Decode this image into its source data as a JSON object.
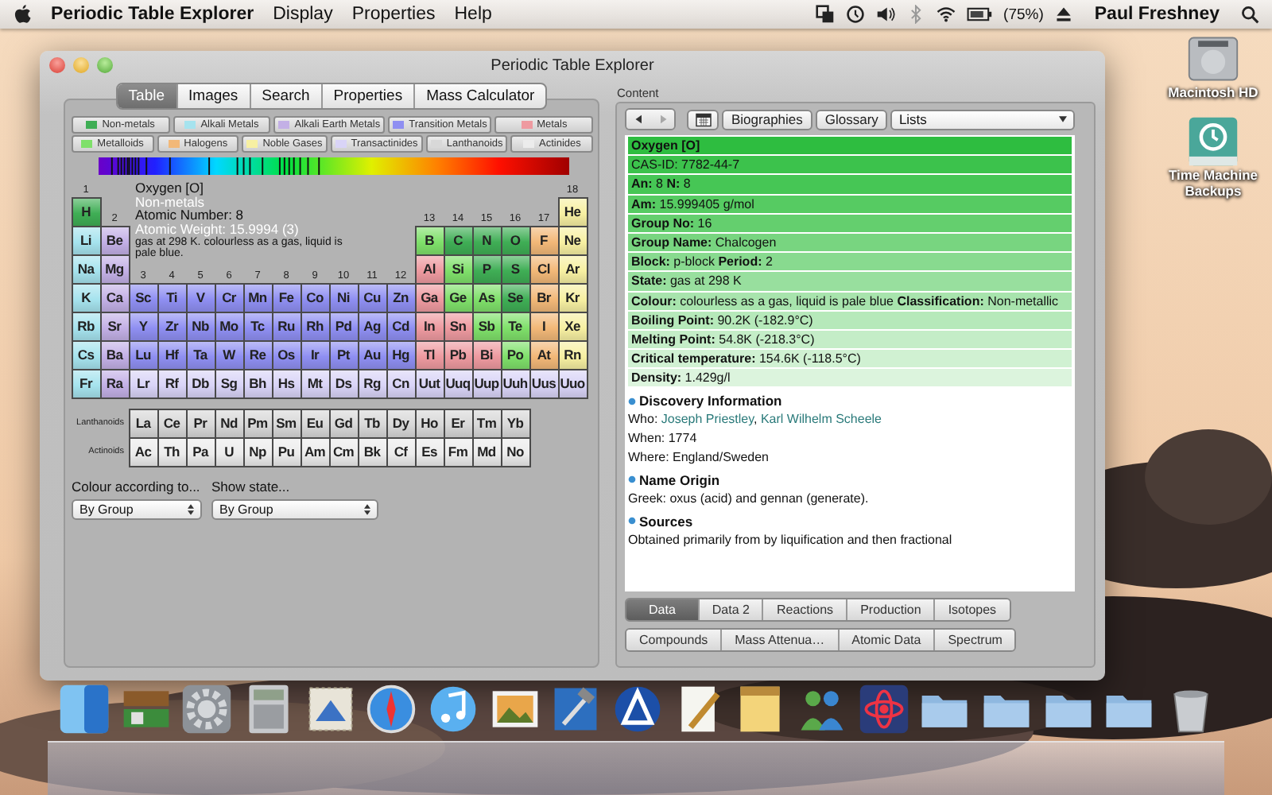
{
  "menu_bar": {
    "app": "Periodic Table Explorer",
    "items": [
      "Display",
      "Properties",
      "Help"
    ],
    "battery": "(75%)",
    "user": "Paul Freshney"
  },
  "desktop_icons": [
    {
      "label": "Macintosh HD",
      "kind": "disk"
    },
    {
      "label": "Time Machine Backups",
      "kind": "backup"
    }
  ],
  "window": {
    "title": "Periodic Table Explorer"
  },
  "left_tabs": [
    {
      "label": "Table",
      "selected": true
    },
    {
      "label": "Images",
      "selected": false
    },
    {
      "label": "Search",
      "selected": false
    },
    {
      "label": "Properties",
      "selected": false
    },
    {
      "label": "Mass Calculator",
      "selected": false
    }
  ],
  "legend": [
    {
      "label": "Non-metals",
      "color": "#3fae55"
    },
    {
      "label": "Alkali Metals",
      "color": "#a6e3ee"
    },
    {
      "label": "Alkali Earth Metals",
      "color": "#c3b0e6"
    },
    {
      "label": "Transition Metals",
      "color": "#8f8ff2"
    },
    {
      "label": "Metals",
      "color": "#ee9aa0"
    },
    {
      "label": "Metalloids",
      "color": "#7fe06a"
    },
    {
      "label": "Halogens",
      "color": "#f2b878"
    },
    {
      "label": "Noble Gases",
      "color": "#f7f0a2"
    },
    {
      "label": "Transactinides",
      "color": "#d9d4f7"
    },
    {
      "label": "Lanthanoids",
      "color": "#d8d8d8"
    },
    {
      "label": "Actinides",
      "color": "#ececec"
    }
  ],
  "table": {
    "info": {
      "name": "Oxygen [O]",
      "category": "Non-metals",
      "number": "Atomic Number: 8",
      "weight": "Atomic Weight: 15.9994 (3)",
      "description": "gas at 298 K. colourless as a gas, liquid is pale blue."
    },
    "rows": [
      [
        {
          "label": "1"
        },
        null,
        null,
        null,
        null,
        null,
        null,
        null,
        null,
        null,
        null,
        null,
        null,
        null,
        null,
        null,
        null,
        {
          "label": "18"
        }
      ],
      [
        {
          "symbol": "H",
          "color": "#3fae55"
        },
        {
          "label": "2"
        },
        null,
        null,
        null,
        null,
        null,
        null,
        null,
        null,
        null,
        null,
        {
          "label": "13"
        },
        {
          "label": "14"
        },
        {
          "label": "15"
        },
        {
          "label": "16"
        },
        {
          "label": "17"
        },
        {
          "symbol": "He",
          "color": "#f7f0a2"
        }
      ],
      [
        {
          "symbol": "Li",
          "color": "#a6e3ee"
        },
        {
          "symbol": "Be",
          "color": "#c3b0e6"
        },
        null,
        null,
        null,
        null,
        null,
        null,
        null,
        null,
        null,
        null,
        {
          "symbol": "B",
          "color": "#7fe06a"
        },
        {
          "symbol": "C",
          "color": "#3fae55"
        },
        {
          "symbol": "N",
          "color": "#3fae55"
        },
        {
          "symbol": "O",
          "color": "#3fae55"
        },
        {
          "symbol": "F",
          "color": "#f2b878"
        },
        {
          "symbol": "Ne",
          "color": "#f7f0a2"
        }
      ],
      [
        {
          "symbol": "Na",
          "color": "#a6e3ee"
        },
        {
          "symbol": "Mg",
          "color": "#c3b0e6"
        },
        {
          "label": "3"
        },
        {
          "label": "4"
        },
        {
          "label": "5"
        },
        {
          "label": "6"
        },
        {
          "label": "7"
        },
        {
          "label": "8"
        },
        {
          "label": "9"
        },
        {
          "label": "10"
        },
        {
          "label": "11"
        },
        {
          "label": "12"
        },
        {
          "symbol": "Al",
          "color": "#ee9aa0"
        },
        {
          "symbol": "Si",
          "color": "#7fe06a"
        },
        {
          "symbol": "P",
          "color": "#3fae55"
        },
        {
          "symbol": "S",
          "color": "#3fae55"
        },
        {
          "symbol": "Cl",
          "color": "#f2b878"
        },
        {
          "symbol": "Ar",
          "color": "#f7f0a2"
        }
      ],
      [
        {
          "symbol": "K",
          "color": "#a6e3ee"
        },
        {
          "symbol": "Ca",
          "color": "#c3b0e6"
        },
        {
          "symbol": "Sc",
          "color": "#8f8ff2"
        },
        {
          "symbol": "Ti",
          "color": "#8f8ff2"
        },
        {
          "symbol": "V",
          "color": "#8f8ff2"
        },
        {
          "symbol": "Cr",
          "color": "#8f8ff2"
        },
        {
          "symbol": "Mn",
          "color": "#8f8ff2"
        },
        {
          "symbol": "Fe",
          "color": "#8f8ff2"
        },
        {
          "symbol": "Co",
          "color": "#8f8ff2"
        },
        {
          "symbol": "Ni",
          "color": "#8f8ff2"
        },
        {
          "symbol": "Cu",
          "color": "#8f8ff2"
        },
        {
          "symbol": "Zn",
          "color": "#8f8ff2"
        },
        {
          "symbol": "Ga",
          "color": "#ee9aa0"
        },
        {
          "symbol": "Ge",
          "color": "#7fe06a"
        },
        {
          "symbol": "As",
          "color": "#7fe06a"
        },
        {
          "symbol": "Se",
          "color": "#3fae55"
        },
        {
          "symbol": "Br",
          "color": "#f2b878"
        },
        {
          "symbol": "Kr",
          "color": "#f7f0a2"
        }
      ],
      [
        {
          "symbol": "Rb",
          "color": "#a6e3ee"
        },
        {
          "symbol": "Sr",
          "color": "#c3b0e6"
        },
        {
          "symbol": "Y",
          "color": "#8f8ff2"
        },
        {
          "symbol": "Zr",
          "color": "#8f8ff2"
        },
        {
          "symbol": "Nb",
          "color": "#8f8ff2"
        },
        {
          "symbol": "Mo",
          "color": "#8f8ff2"
        },
        {
          "symbol": "Tc",
          "color": "#8f8ff2"
        },
        {
          "symbol": "Ru",
          "color": "#8f8ff2"
        },
        {
          "symbol": "Rh",
          "color": "#8f8ff2"
        },
        {
          "symbol": "Pd",
          "color": "#8f8ff2"
        },
        {
          "symbol": "Ag",
          "color": "#8f8ff2"
        },
        {
          "symbol": "Cd",
          "color": "#8f8ff2"
        },
        {
          "symbol": "In",
          "color": "#ee9aa0"
        },
        {
          "symbol": "Sn",
          "color": "#ee9aa0"
        },
        {
          "symbol": "Sb",
          "color": "#7fe06a"
        },
        {
          "symbol": "Te",
          "color": "#7fe06a"
        },
        {
          "symbol": "I",
          "color": "#f2b878"
        },
        {
          "symbol": "Xe",
          "color": "#f7f0a2"
        }
      ],
      [
        {
          "symbol": "Cs",
          "color": "#a6e3ee"
        },
        {
          "symbol": "Ba",
          "color": "#c3b0e6"
        },
        {
          "symbol": "Lu",
          "color": "#8f8ff2"
        },
        {
          "symbol": "Hf",
          "color": "#8f8ff2"
        },
        {
          "symbol": "Ta",
          "color": "#8f8ff2"
        },
        {
          "symbol": "W",
          "color": "#8f8ff2"
        },
        {
          "symbol": "Re",
          "color": "#8f8ff2"
        },
        {
          "symbol": "Os",
          "color": "#8f8ff2"
        },
        {
          "symbol": "Ir",
          "color": "#8f8ff2"
        },
        {
          "symbol": "Pt",
          "color": "#8f8ff2"
        },
        {
          "symbol": "Au",
          "color": "#8f8ff2"
        },
        {
          "symbol": "Hg",
          "color": "#8f8ff2"
        },
        {
          "symbol": "Tl",
          "color": "#ee9aa0"
        },
        {
          "symbol": "Pb",
          "color": "#ee9aa0"
        },
        {
          "symbol": "Bi",
          "color": "#ee9aa0"
        },
        {
          "symbol": "Po",
          "color": "#7fe06a"
        },
        {
          "symbol": "At",
          "color": "#f2b878"
        },
        {
          "symbol": "Rn",
          "color": "#f7f0a2"
        }
      ],
      [
        {
          "symbol": "Fr",
          "color": "#a6e3ee"
        },
        {
          "symbol": "Ra",
          "color": "#c3b0e6"
        },
        {
          "symbol": "Lr",
          "color": "#d9d4f7"
        },
        {
          "symbol": "Rf",
          "color": "#d9d4f7"
        },
        {
          "symbol": "Db",
          "color": "#d9d4f7"
        },
        {
          "symbol": "Sg",
          "color": "#d9d4f7"
        },
        {
          "symbol": "Bh",
          "color": "#d9d4f7"
        },
        {
          "symbol": "Hs",
          "color": "#d9d4f7"
        },
        {
          "symbol": "Mt",
          "color": "#d9d4f7"
        },
        {
          "symbol": "Ds",
          "color": "#d9d4f7"
        },
        {
          "symbol": "Rg",
          "color": "#d9d4f7"
        },
        {
          "symbol": "Cn",
          "color": "#d9d4f7"
        },
        {
          "symbol": "Uut",
          "color": "#d9d4f7"
        },
        {
          "symbol": "Uuq",
          "color": "#d9d4f7"
        },
        {
          "symbol": "Uup",
          "color": "#d9d4f7"
        },
        {
          "symbol": "Uuh",
          "color": "#d9d4f7"
        },
        {
          "symbol": "Uus",
          "color": "#d9d4f7"
        },
        {
          "symbol": "Uuo",
          "color": "#d9d4f7"
        }
      ]
    ],
    "series": [
      {
        "label": "Lanthanoids",
        "elements": [
          {
            "symbol": "La",
            "color": "#d8d8d8"
          },
          {
            "symbol": "Ce",
            "color": "#d8d8d8"
          },
          {
            "symbol": "Pr",
            "color": "#d8d8d8"
          },
          {
            "symbol": "Nd",
            "color": "#d8d8d8"
          },
          {
            "symbol": "Pm",
            "color": "#d8d8d8"
          },
          {
            "symbol": "Sm",
            "color": "#d8d8d8"
          },
          {
            "symbol": "Eu",
            "color": "#d8d8d8"
          },
          {
            "symbol": "Gd",
            "color": "#d8d8d8"
          },
          {
            "symbol": "Tb",
            "color": "#d8d8d8"
          },
          {
            "symbol": "Dy",
            "color": "#d8d8d8"
          },
          {
            "symbol": "Ho",
            "color": "#d8d8d8"
          },
          {
            "symbol": "Er",
            "color": "#d8d8d8"
          },
          {
            "symbol": "Tm",
            "color": "#d8d8d8"
          },
          {
            "symbol": "Yb",
            "color": "#d8d8d8"
          }
        ]
      },
      {
        "label": "Actinoids",
        "elements": [
          {
            "symbol": "Ac",
            "color": "#ececec"
          },
          {
            "symbol": "Th",
            "color": "#ececec"
          },
          {
            "symbol": "Pa",
            "color": "#ececec"
          },
          {
            "symbol": "U",
            "color": "#ececec"
          },
          {
            "symbol": "Np",
            "color": "#ececec"
          },
          {
            "symbol": "Pu",
            "color": "#ececec"
          },
          {
            "symbol": "Am",
            "color": "#ececec"
          },
          {
            "symbol": "Cm",
            "color": "#ececec"
          },
          {
            "symbol": "Bk",
            "color": "#ececec"
          },
          {
            "symbol": "Cf",
            "color": "#ececec"
          },
          {
            "symbol": "Es",
            "color": "#ececec"
          },
          {
            "symbol": "Fm",
            "color": "#ececec"
          },
          {
            "symbol": "Md",
            "color": "#ececec"
          },
          {
            "symbol": "No",
            "color": "#ececec"
          }
        ]
      }
    ]
  },
  "options": {
    "colour_label": "Colour according to...",
    "colour_value": "By Group",
    "state_label": "Show state...",
    "state_value": "By Group"
  },
  "content": {
    "label": "Content",
    "forward_disabled": true,
    "buttons": [
      "Biographies",
      "Glossary"
    ],
    "list": "Lists",
    "rows": [
      {
        "text": "Oxygen [O]",
        "kind": "title",
        "color": "#2ebd40"
      },
      {
        "text": "CAS-ID: 7782-44-7",
        "kind": "plain",
        "color": "#3cc24c"
      },
      {
        "text": "**An:** 8 **N:** 8",
        "kind": "plain",
        "color": "#46c655"
      },
      {
        "text": "**Am:** 15.999405 g/mol",
        "kind": "plain",
        "color": "#56cb62"
      },
      {
        "text": "**Group No:** 16",
        "kind": "plain",
        "color": "#64cf6e"
      },
      {
        "text": "**Group Name:** Chalcogen",
        "kind": "plain",
        "color": "#78d580"
      },
      {
        "text": "**Block:** p-block  **Period:** 2",
        "kind": "plain",
        "color": "#88da8f"
      },
      {
        "text": "**State:** gas at 298 K",
        "kind": "plain",
        "color": "#98df9e"
      },
      {
        "text": "**Colour:** colourless as a gas, liquid is pale blue **Classification:** Non-metallic",
        "kind": "plain",
        "color": "#a8e4ad"
      },
      {
        "text": "**Boiling Point:** 90.2K (-182.9°C)",
        "kind": "plain",
        "color": "#b6e9ba"
      },
      {
        "text": "**Melting Point:** 54.8K (-218.3°C)",
        "kind": "plain",
        "color": "#c4edc7"
      },
      {
        "text": "**Critical temperature:** 154.6K (-118.5°C)",
        "kind": "plain",
        "color": "#d0f1d2"
      },
      {
        "text": "**Density:** 1.429g/l",
        "kind": "plain",
        "color": "#dcf4dd"
      }
    ],
    "sections": [
      {
        "heading": "Discovery Information",
        "lines": [
          {
            "label": "Who: ",
            "links": [
              "Joseph Priestley",
              "Karl Wilhelm Scheele"
            ],
            "separator": ", "
          },
          {
            "text": "When: 1774"
          },
          {
            "text": "Where: England/Sweden"
          }
        ]
      },
      {
        "heading": "Name Origin",
        "lines": [
          {
            "text": "Greek: oxus (acid) and gennan (generate)."
          }
        ]
      },
      {
        "heading": "Sources",
        "lines": [
          {
            "text": "Obtained primarily from by liquification and then fractional"
          }
        ]
      }
    ],
    "tabs_row1": [
      {
        "label": "Data",
        "selected": true
      },
      {
        "label": "Data 2",
        "selected": false
      },
      {
        "label": "Reactions",
        "selected": false
      },
      {
        "label": "Production",
        "selected": false
      },
      {
        "label": "Isotopes",
        "selected": false
      }
    ],
    "tabs_row2": [
      {
        "label": "Compounds",
        "selected": false
      },
      {
        "label": "Mass Attenua…",
        "selected": false
      },
      {
        "label": "Atomic Data",
        "selected": false
      },
      {
        "label": "Spectrum",
        "selected": false
      }
    ]
  }
}
